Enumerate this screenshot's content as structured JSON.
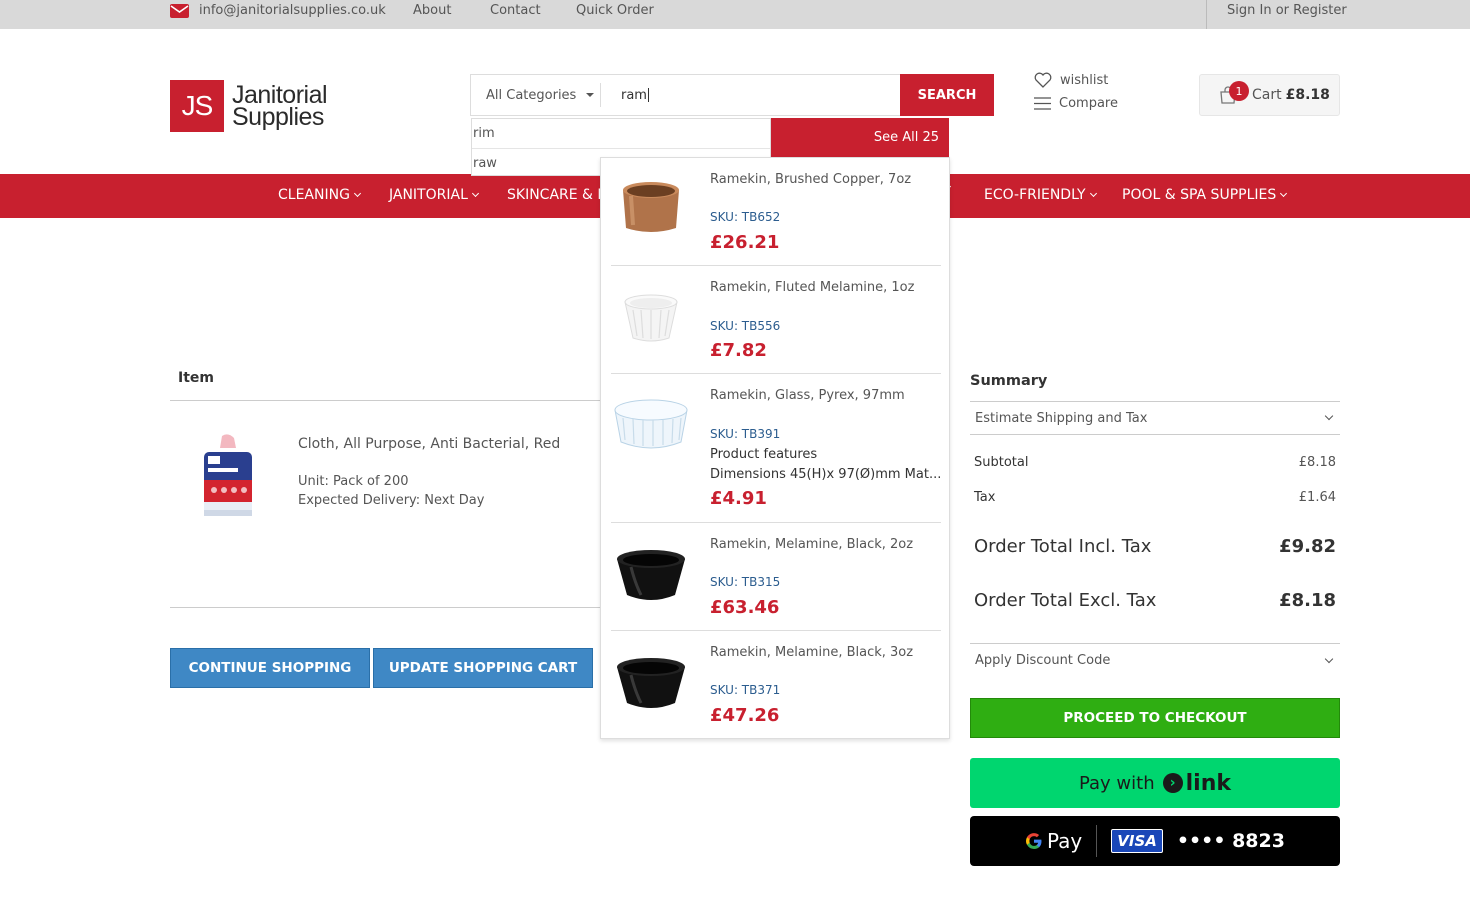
{
  "topbar": {
    "email": "info@janitorialsupplies.co.uk",
    "links": [
      "About",
      "Contact",
      "Quick Order"
    ],
    "sign_in": "Sign In",
    "or": "or",
    "register": "Register"
  },
  "header": {
    "logo_mark": "JS",
    "logo_line1": "Janitorial",
    "logo_line2": "Supplies",
    "search": {
      "category": "All Categories",
      "query": "ram",
      "button": "SEARCH"
    },
    "wishlist": "wishlist",
    "compare": "Compare",
    "cart_count": "1",
    "cart_label": "Cart",
    "cart_amount": "£8.18"
  },
  "nav": {
    "items": [
      "CLEANING",
      "JANITORIAL",
      "SKINCARE & H",
      "ECO-FRIENDLY",
      "POOL & SPA SUPPLIES"
    ]
  },
  "cart": {
    "item_header": "Item",
    "product_name": "Cloth, All Purpose, Anti Bacterial, Red",
    "unit": "Unit: Pack of 200",
    "delivery": "Expected Delivery: Next Day",
    "continue_button": "CONTINUE SHOPPING",
    "update_button": "UPDATE SHOPPING CART"
  },
  "summary": {
    "title": "Summary",
    "shipping": "Estimate Shipping and Tax",
    "subtotal_label": "Subtotal",
    "subtotal_value": "£8.18",
    "tax_label": "Tax",
    "tax_value": "£1.64",
    "incl_label": "Order Total Incl. Tax",
    "incl_value": "£9.82",
    "excl_label": "Order Total Excl. Tax",
    "excl_value": "£8.18",
    "discount": "Apply Discount Code",
    "checkout": "PROCEED TO CHECKOUT",
    "paylink_text": "Pay with",
    "paylink_brand": "link",
    "gpay_text": "Pay",
    "gpay_card_brand": "VISA",
    "gpay_card": "•••• 8823"
  },
  "suggestions": {
    "terms": [
      "rim",
      "raw"
    ],
    "see_all": "See All 25"
  },
  "results": [
    {
      "name": "Ramekin, Brushed Copper, 7oz",
      "sku": "SKU: TB652",
      "price": "£26.21"
    },
    {
      "name": "Ramekin, Fluted Melamine, 1oz",
      "sku": "SKU: TB556",
      "price": "£7.82"
    },
    {
      "name": "Ramekin, Glass, Pyrex, 97mm",
      "sku": "SKU: TB391",
      "features_title": "Product features",
      "features_text": "Dimensions 45(H)x 97(Ø)mm Mat...",
      "price": "£4.91"
    },
    {
      "name": "Ramekin, Melamine, Black, 2oz",
      "sku": "SKU: TB315",
      "price": "£63.46"
    },
    {
      "name": "Ramekin, Melamine, Black, 3oz",
      "sku": "SKU: TB371",
      "price": "£47.26"
    }
  ],
  "colors": {
    "brand_red": "#c8202f",
    "button_blue": "#3f88c5",
    "checkout_green": "#2fae12",
    "link_green": "#00d66f"
  }
}
